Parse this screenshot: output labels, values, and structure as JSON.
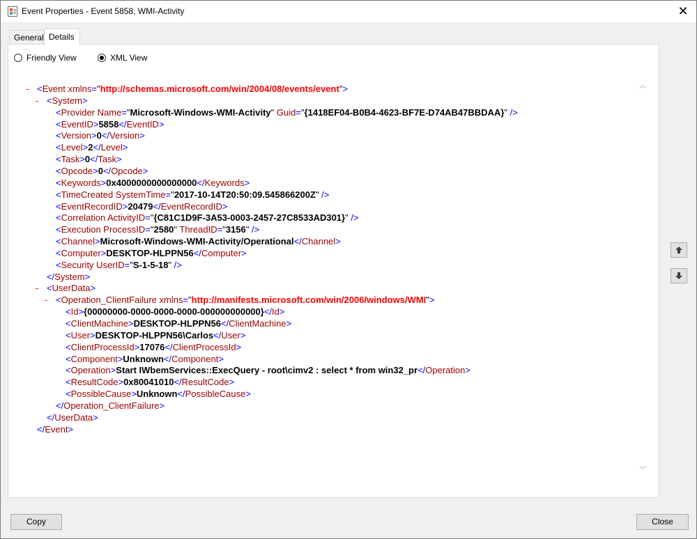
{
  "window": {
    "title": "Event Properties - Event 5858, WMI-Activity",
    "close_glyph": "✕"
  },
  "tabs": [
    {
      "label": "General",
      "selected": false
    },
    {
      "label": "Details",
      "selected": true
    }
  ],
  "view_options": {
    "friendly_label": "Friendly View",
    "xml_label": "XML View",
    "selected": "XML View"
  },
  "xml_lines": [
    {
      "indent": 0,
      "collapse": "-",
      "parts": [
        [
          "br",
          "<"
        ],
        [
          "tag",
          "Event"
        ],
        [
          "attr",
          " xmlns"
        ],
        [
          "eq",
          "="
        ],
        [
          "q",
          "\""
        ],
        [
          "ns",
          "http://schemas.microsoft.com/win/2004/08/events/event"
        ],
        [
          "q",
          "\""
        ],
        [
          "br",
          ">"
        ]
      ]
    },
    {
      "indent": 1,
      "collapse": "-",
      "parts": [
        [
          "br",
          "<"
        ],
        [
          "tag",
          "System"
        ],
        [
          "br",
          ">"
        ]
      ]
    },
    {
      "indent": 2,
      "collapse": "",
      "parts": [
        [
          "br",
          "<"
        ],
        [
          "tag",
          "Provider"
        ],
        [
          "attr",
          " Name"
        ],
        [
          "eq",
          "="
        ],
        [
          "q",
          "\""
        ],
        [
          "val",
          "Microsoft-Windows-WMI-Activity"
        ],
        [
          "q",
          "\""
        ],
        [
          "attr",
          " Guid"
        ],
        [
          "eq",
          "="
        ],
        [
          "q",
          "\""
        ],
        [
          "val",
          "{1418EF04-B0B4-4623-BF7E-D74AB47BBDAA}"
        ],
        [
          "q",
          "\""
        ],
        [
          "br",
          " />"
        ]
      ]
    },
    {
      "indent": 2,
      "collapse": "",
      "parts": [
        [
          "br",
          "<"
        ],
        [
          "tag",
          "EventID"
        ],
        [
          "br",
          ">"
        ],
        [
          "txt",
          "5858"
        ],
        [
          "br",
          "</"
        ],
        [
          "tag",
          "EventID"
        ],
        [
          "br",
          ">"
        ]
      ]
    },
    {
      "indent": 2,
      "collapse": "",
      "parts": [
        [
          "br",
          "<"
        ],
        [
          "tag",
          "Version"
        ],
        [
          "br",
          ">"
        ],
        [
          "txt",
          "0"
        ],
        [
          "br",
          "</"
        ],
        [
          "tag",
          "Version"
        ],
        [
          "br",
          ">"
        ]
      ]
    },
    {
      "indent": 2,
      "collapse": "",
      "parts": [
        [
          "br",
          "<"
        ],
        [
          "tag",
          "Level"
        ],
        [
          "br",
          ">"
        ],
        [
          "txt",
          "2"
        ],
        [
          "br",
          "</"
        ],
        [
          "tag",
          "Level"
        ],
        [
          "br",
          ">"
        ]
      ]
    },
    {
      "indent": 2,
      "collapse": "",
      "parts": [
        [
          "br",
          "<"
        ],
        [
          "tag",
          "Task"
        ],
        [
          "br",
          ">"
        ],
        [
          "txt",
          "0"
        ],
        [
          "br",
          "</"
        ],
        [
          "tag",
          "Task"
        ],
        [
          "br",
          ">"
        ]
      ]
    },
    {
      "indent": 2,
      "collapse": "",
      "parts": [
        [
          "br",
          "<"
        ],
        [
          "tag",
          "Opcode"
        ],
        [
          "br",
          ">"
        ],
        [
          "txt",
          "0"
        ],
        [
          "br",
          "</"
        ],
        [
          "tag",
          "Opcode"
        ],
        [
          "br",
          ">"
        ]
      ]
    },
    {
      "indent": 2,
      "collapse": "",
      "parts": [
        [
          "br",
          "<"
        ],
        [
          "tag",
          "Keywords"
        ],
        [
          "br",
          ">"
        ],
        [
          "txt",
          "0x4000000000000000"
        ],
        [
          "br",
          "</"
        ],
        [
          "tag",
          "Keywords"
        ],
        [
          "br",
          ">"
        ]
      ]
    },
    {
      "indent": 2,
      "collapse": "",
      "parts": [
        [
          "br",
          "<"
        ],
        [
          "tag",
          "TimeCreated"
        ],
        [
          "attr",
          " SystemTime"
        ],
        [
          "eq",
          "="
        ],
        [
          "q",
          "\""
        ],
        [
          "val",
          "2017-10-14T20:50:09.545866200Z"
        ],
        [
          "q",
          "\""
        ],
        [
          "br",
          " />"
        ]
      ]
    },
    {
      "indent": 2,
      "collapse": "",
      "parts": [
        [
          "br",
          "<"
        ],
        [
          "tag",
          "EventRecordID"
        ],
        [
          "br",
          ">"
        ],
        [
          "txt",
          "20479"
        ],
        [
          "br",
          "</"
        ],
        [
          "tag",
          "EventRecordID"
        ],
        [
          "br",
          ">"
        ]
      ]
    },
    {
      "indent": 2,
      "collapse": "",
      "parts": [
        [
          "br",
          "<"
        ],
        [
          "tag",
          "Correlation"
        ],
        [
          "attr",
          " ActivityID"
        ],
        [
          "eq",
          "="
        ],
        [
          "q",
          "\""
        ],
        [
          "val",
          "{C81C1D9F-3A53-0003-2457-27C8533AD301}"
        ],
        [
          "q",
          "\""
        ],
        [
          "br",
          " />"
        ]
      ]
    },
    {
      "indent": 2,
      "collapse": "",
      "parts": [
        [
          "br",
          "<"
        ],
        [
          "tag",
          "Execution"
        ],
        [
          "attr",
          " ProcessID"
        ],
        [
          "eq",
          "="
        ],
        [
          "q",
          "\""
        ],
        [
          "val",
          "2580"
        ],
        [
          "q",
          "\""
        ],
        [
          "attr",
          " ThreadID"
        ],
        [
          "eq",
          "="
        ],
        [
          "q",
          "\""
        ],
        [
          "val",
          "3156"
        ],
        [
          "q",
          "\""
        ],
        [
          "br",
          " />"
        ]
      ]
    },
    {
      "indent": 2,
      "collapse": "",
      "parts": [
        [
          "br",
          "<"
        ],
        [
          "tag",
          "Channel"
        ],
        [
          "br",
          ">"
        ],
        [
          "txt",
          "Microsoft-Windows-WMI-Activity/Operational"
        ],
        [
          "br",
          "</"
        ],
        [
          "tag",
          "Channel"
        ],
        [
          "br",
          ">"
        ]
      ]
    },
    {
      "indent": 2,
      "collapse": "",
      "parts": [
        [
          "br",
          "<"
        ],
        [
          "tag",
          "Computer"
        ],
        [
          "br",
          ">"
        ],
        [
          "txt",
          "DESKTOP-HLPPN56"
        ],
        [
          "br",
          "</"
        ],
        [
          "tag",
          "Computer"
        ],
        [
          "br",
          ">"
        ]
      ]
    },
    {
      "indent": 2,
      "collapse": "",
      "parts": [
        [
          "br",
          "<"
        ],
        [
          "tag",
          "Security"
        ],
        [
          "attr",
          " UserID"
        ],
        [
          "eq",
          "="
        ],
        [
          "q",
          "\""
        ],
        [
          "val",
          "S-1-5-18"
        ],
        [
          "q",
          "\""
        ],
        [
          "br",
          " />"
        ]
      ]
    },
    {
      "indent": 1,
      "collapse": "",
      "parts": [
        [
          "br",
          "</"
        ],
        [
          "tag",
          "System"
        ],
        [
          "br",
          ">"
        ]
      ]
    },
    {
      "indent": 1,
      "collapse": "-",
      "parts": [
        [
          "br",
          "<"
        ],
        [
          "tag",
          "UserData"
        ],
        [
          "br",
          ">"
        ]
      ]
    },
    {
      "indent": 2,
      "collapse": "-",
      "parts": [
        [
          "br",
          "<"
        ],
        [
          "tag",
          "Operation_ClientFailure"
        ],
        [
          "attr",
          " xmlns"
        ],
        [
          "eq",
          "="
        ],
        [
          "q",
          "\""
        ],
        [
          "ns",
          "http://manifests.microsoft.com/win/2006/windows/WMI"
        ],
        [
          "q",
          "\""
        ],
        [
          "br",
          ">"
        ]
      ]
    },
    {
      "indent": 3,
      "collapse": "",
      "parts": [
        [
          "br",
          "<"
        ],
        [
          "tag",
          "Id"
        ],
        [
          "br",
          ">"
        ],
        [
          "txt",
          "{00000000-0000-0000-0000-000000000000}"
        ],
        [
          "br",
          "</"
        ],
        [
          "tag",
          "Id"
        ],
        [
          "br",
          ">"
        ]
      ]
    },
    {
      "indent": 3,
      "collapse": "",
      "parts": [
        [
          "br",
          "<"
        ],
        [
          "tag",
          "ClientMachine"
        ],
        [
          "br",
          ">"
        ],
        [
          "txt",
          "DESKTOP-HLPPN56"
        ],
        [
          "br",
          "</"
        ],
        [
          "tag",
          "ClientMachine"
        ],
        [
          "br",
          ">"
        ]
      ]
    },
    {
      "indent": 3,
      "collapse": "",
      "parts": [
        [
          "br",
          "<"
        ],
        [
          "tag",
          "User"
        ],
        [
          "br",
          ">"
        ],
        [
          "txt",
          "DESKTOP-HLPPN56\\Carlos"
        ],
        [
          "br",
          "</"
        ],
        [
          "tag",
          "User"
        ],
        [
          "br",
          ">"
        ]
      ]
    },
    {
      "indent": 3,
      "collapse": "",
      "parts": [
        [
          "br",
          "<"
        ],
        [
          "tag",
          "ClientProcessId"
        ],
        [
          "br",
          ">"
        ],
        [
          "txt",
          "17076"
        ],
        [
          "br",
          "</"
        ],
        [
          "tag",
          "ClientProcessId"
        ],
        [
          "br",
          ">"
        ]
      ]
    },
    {
      "indent": 3,
      "collapse": "",
      "parts": [
        [
          "br",
          "<"
        ],
        [
          "tag",
          "Component"
        ],
        [
          "br",
          ">"
        ],
        [
          "txt",
          "Unknown"
        ],
        [
          "br",
          "</"
        ],
        [
          "tag",
          "Component"
        ],
        [
          "br",
          ">"
        ]
      ]
    },
    {
      "indent": 3,
      "collapse": "",
      "parts": [
        [
          "br",
          "<"
        ],
        [
          "tag",
          "Operation"
        ],
        [
          "br",
          ">"
        ],
        [
          "txt",
          "Start IWbemServices::ExecQuery - root\\cimv2 : select * from win32_pr"
        ],
        [
          "br",
          "</"
        ],
        [
          "tag",
          "Operation"
        ],
        [
          "br",
          ">"
        ]
      ]
    },
    {
      "indent": 3,
      "collapse": "",
      "parts": [
        [
          "br",
          "<"
        ],
        [
          "tag",
          "ResultCode"
        ],
        [
          "br",
          ">"
        ],
        [
          "txt",
          "0x80041010"
        ],
        [
          "br",
          "</"
        ],
        [
          "tag",
          "ResultCode"
        ],
        [
          "br",
          ">"
        ]
      ]
    },
    {
      "indent": 3,
      "collapse": "",
      "parts": [
        [
          "br",
          "<"
        ],
        [
          "tag",
          "PossibleCause"
        ],
        [
          "br",
          ">"
        ],
        [
          "txt",
          "Unknown"
        ],
        [
          "br",
          "</"
        ],
        [
          "tag",
          "PossibleCause"
        ],
        [
          "br",
          ">"
        ]
      ]
    },
    {
      "indent": 2,
      "collapse": "",
      "parts": [
        [
          "br",
          "</"
        ],
        [
          "tag",
          "Operation_ClientFailure"
        ],
        [
          "br",
          ">"
        ]
      ]
    },
    {
      "indent": 1,
      "collapse": "",
      "parts": [
        [
          "br",
          "</"
        ],
        [
          "tag",
          "UserData"
        ],
        [
          "br",
          ">"
        ]
      ]
    },
    {
      "indent": 0,
      "collapse": "",
      "parts": [
        [
          "br",
          "</"
        ],
        [
          "tag",
          "Event"
        ],
        [
          "br",
          ">"
        ]
      ]
    }
  ],
  "nav": {
    "up_icon": "arrow-up-icon",
    "down_icon": "arrow-down-icon"
  },
  "buttons": {
    "copy_label": "Copy",
    "close_label": "Close"
  }
}
